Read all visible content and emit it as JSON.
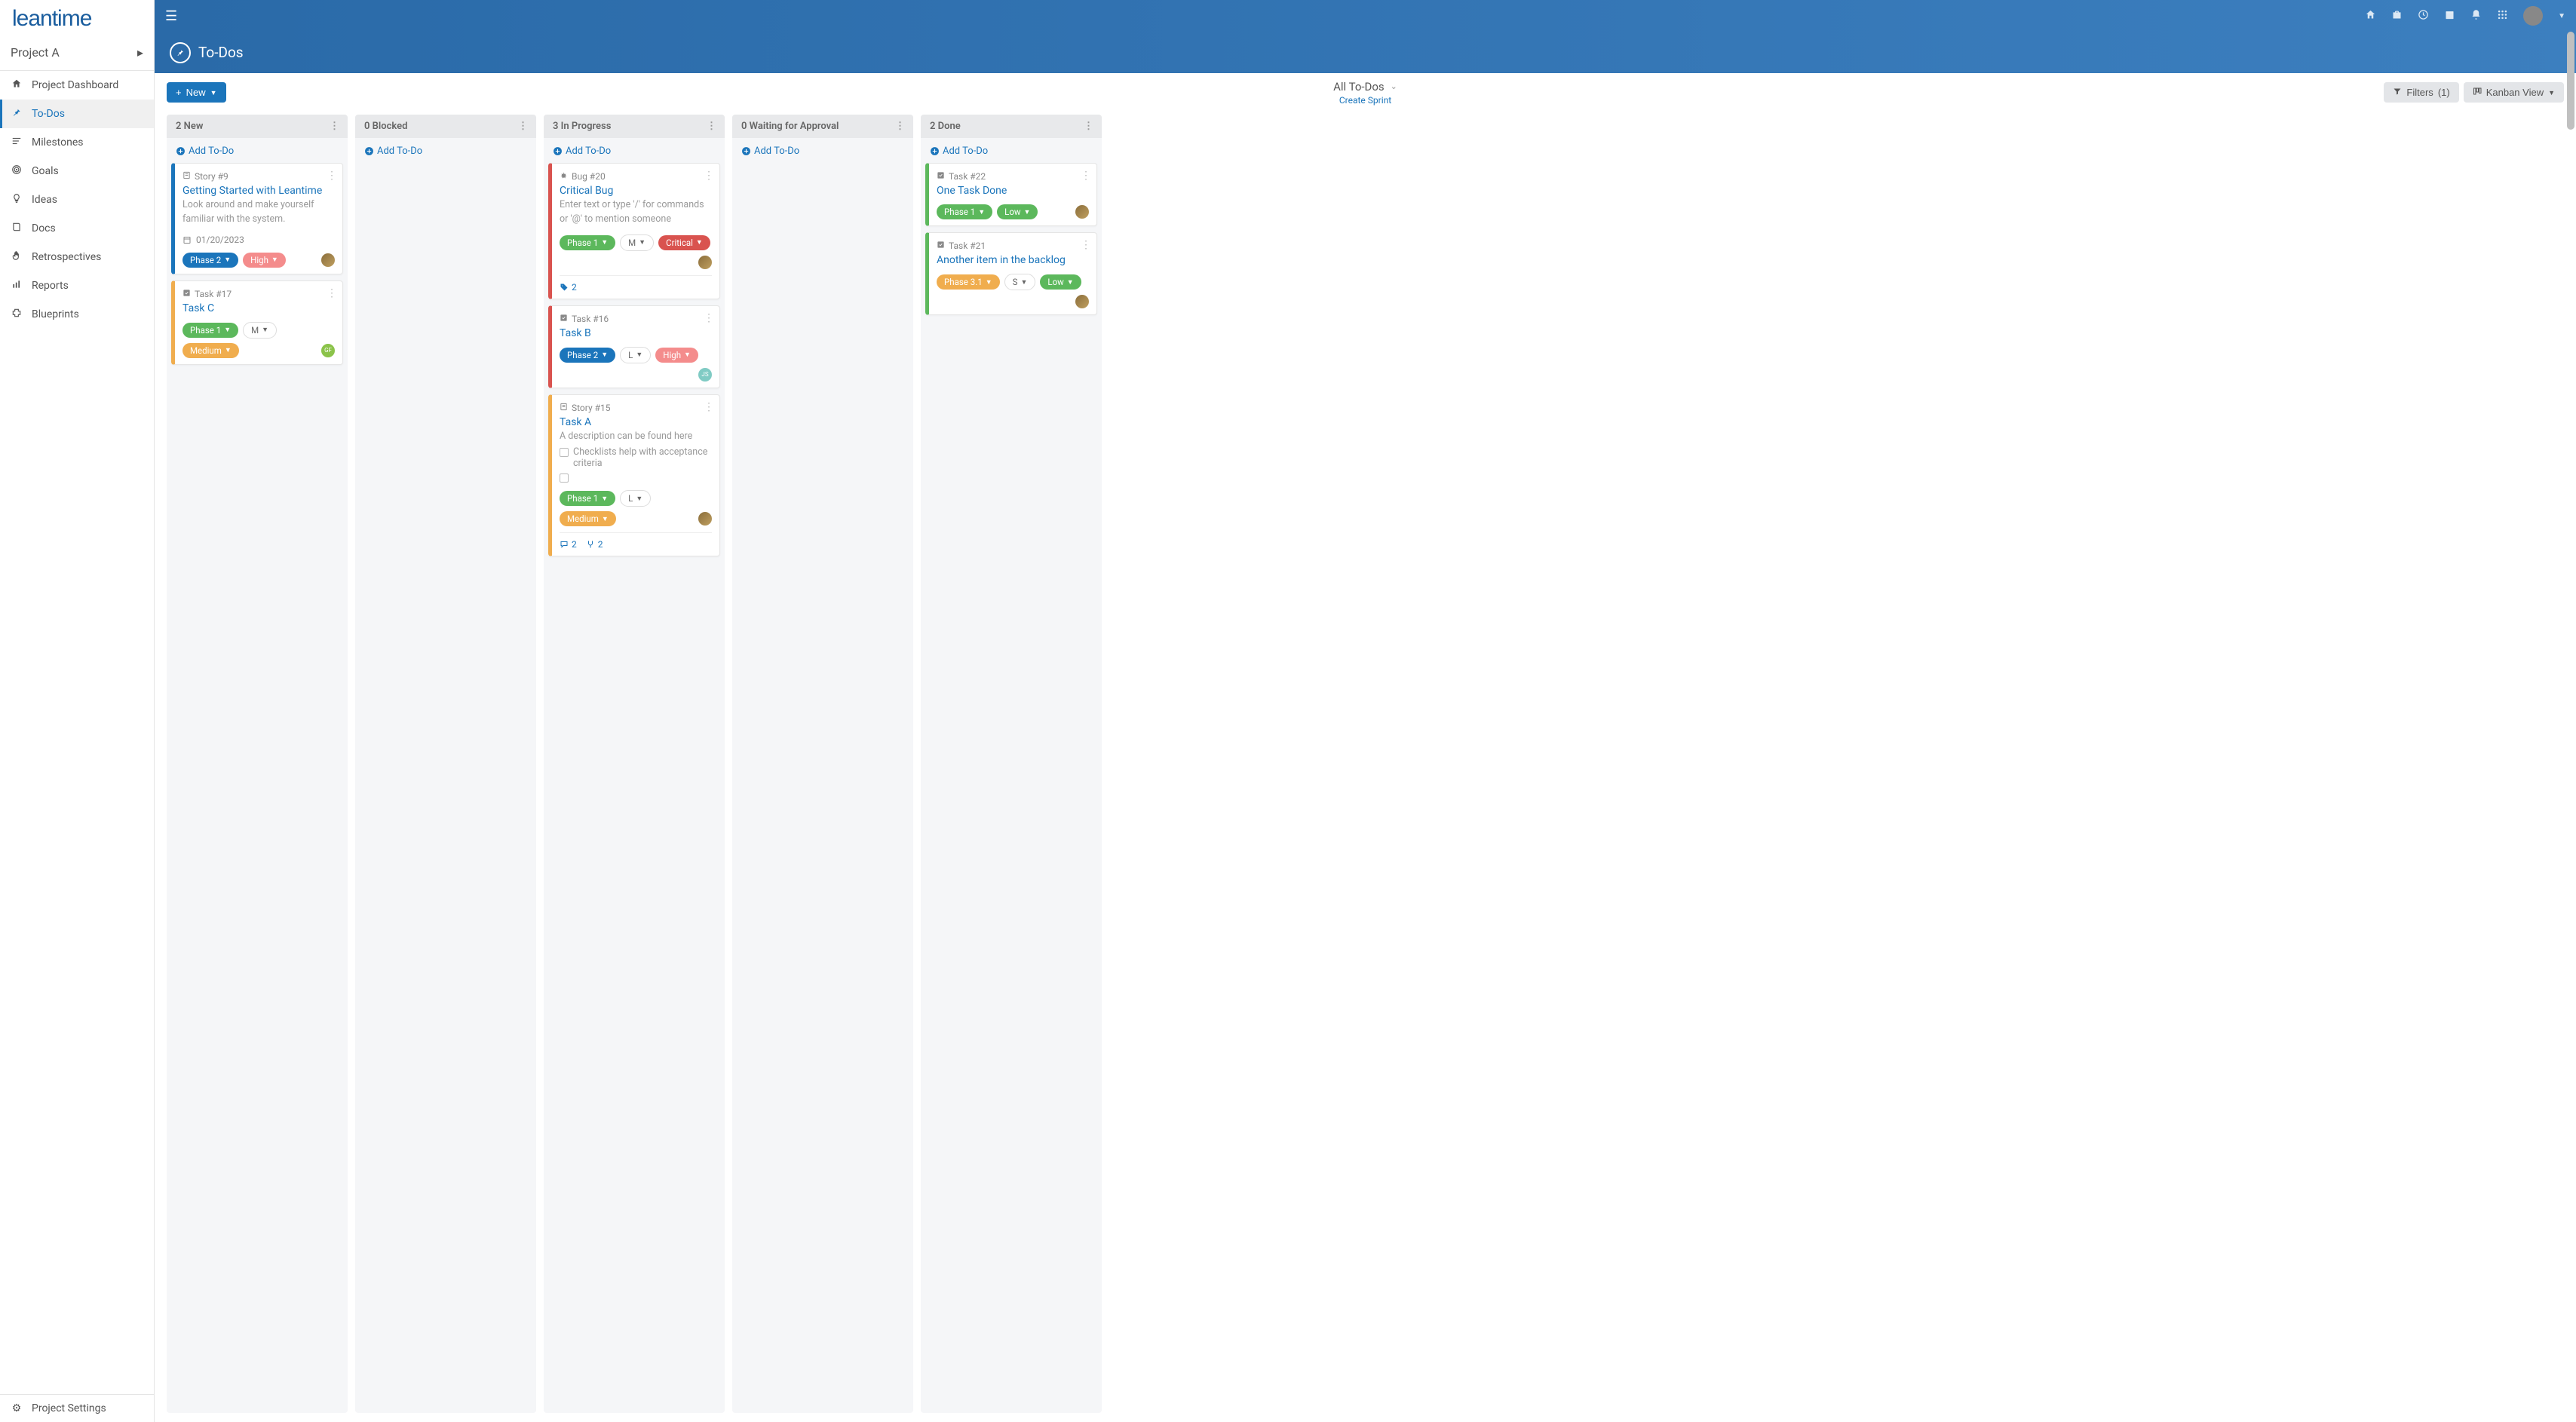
{
  "logo": "leantime",
  "project": {
    "name": "Project A"
  },
  "nav": [
    {
      "label": "Project Dashboard",
      "icon": "home"
    },
    {
      "label": "To-Dos",
      "icon": "pin",
      "active": true
    },
    {
      "label": "Milestones",
      "icon": "bars"
    },
    {
      "label": "Goals",
      "icon": "target"
    },
    {
      "label": "Ideas",
      "icon": "bulb"
    },
    {
      "label": "Docs",
      "icon": "book"
    },
    {
      "label": "Retrospectives",
      "icon": "hand"
    },
    {
      "label": "Reports",
      "icon": "chart"
    },
    {
      "label": "Blueprints",
      "icon": "puzzle"
    }
  ],
  "settings_label": "Project Settings",
  "page_title": "To-Dos",
  "toolbar": {
    "new_label": "New",
    "filter_dropdown": "All To-Dos",
    "create_sprint": "Create Sprint",
    "filters_label": "Filters",
    "filters_count": "(1)",
    "view_label": "Kanban View"
  },
  "add_todo_label": "Add To-Do",
  "columns": [
    {
      "title": "2 New",
      "cards": [
        {
          "border": "blue",
          "type_icon": "story",
          "type": "Story #9",
          "title": "Getting Started with Leantime",
          "desc": "Look around and make yourself familiar with the system.",
          "date": "01/20/2023",
          "pills": [
            {
              "text": "Phase 2",
              "style": "blue"
            },
            {
              "text": "High",
              "style": "lightred"
            }
          ],
          "avatar": "img"
        },
        {
          "border": "yellow",
          "type_icon": "task",
          "type": "Task #17",
          "title": "Task C",
          "pills": [
            {
              "text": "Phase 1",
              "style": "green"
            },
            {
              "text": "M",
              "style": "white"
            },
            {
              "text": "Medium",
              "style": "yellow"
            }
          ],
          "avatar": "GF",
          "avatar_style": "green"
        }
      ]
    },
    {
      "title": "0 Blocked",
      "cards": []
    },
    {
      "title": "3 In Progress",
      "cards": [
        {
          "border": "red",
          "type_icon": "bug",
          "type": "Bug #20",
          "title": "Critical Bug",
          "placeholder": "Enter text or type '/' for commands or '@' to mention someone",
          "pills": [
            {
              "text": "Phase 1",
              "style": "green"
            },
            {
              "text": "M",
              "style": "white"
            },
            {
              "text": "Critical",
              "style": "red"
            }
          ],
          "avatar": "img",
          "meta": {
            "tags": "2"
          }
        },
        {
          "border": "red",
          "type_icon": "task",
          "type": "Task #16",
          "title": "Task B",
          "pills": [
            {
              "text": "Phase 2",
              "style": "blue"
            },
            {
              "text": "L",
              "style": "white"
            },
            {
              "text": "High",
              "style": "lightred"
            }
          ],
          "avatar": "JS",
          "avatar_style": "teal"
        },
        {
          "border": "yellow",
          "type_icon": "story",
          "type": "Story #15",
          "title": "Task A",
          "desc": "A description can be found here",
          "checklist": [
            "Checklists help with acceptance criteria"
          ],
          "pills": [
            {
              "text": "Phase 1",
              "style": "green"
            },
            {
              "text": "L",
              "style": "white"
            },
            {
              "text": "Medium",
              "style": "yellow"
            }
          ],
          "avatar": "img",
          "meta": {
            "comments": "2",
            "subtasks": "2"
          }
        }
      ]
    },
    {
      "title": "0 Waiting for Approval",
      "cards": []
    },
    {
      "title": "2 Done",
      "cards": [
        {
          "border": "green",
          "type_icon": "task",
          "type": "Task #22",
          "title": "One Task Done",
          "pills": [
            {
              "text": "Phase 1",
              "style": "green"
            },
            {
              "text": "Low",
              "style": "green"
            }
          ],
          "avatar": "img"
        },
        {
          "border": "green",
          "type_icon": "task",
          "type": "Task #21",
          "title": "Another item in the backlog",
          "pills": [
            {
              "text": "Phase 3.1",
              "style": "yellow"
            },
            {
              "text": "S",
              "style": "white"
            },
            {
              "text": "Low",
              "style": "green"
            }
          ],
          "avatar": "img"
        }
      ]
    }
  ]
}
